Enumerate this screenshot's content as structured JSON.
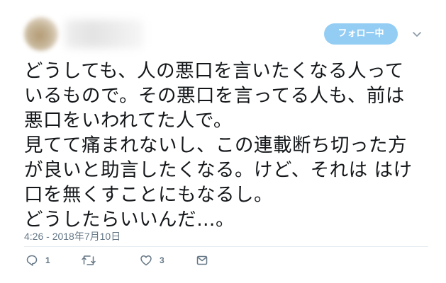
{
  "header": {
    "follow_label": "フォロー中"
  },
  "tweet": {
    "lines": [
      "どうしても、人の悪口を言いたくなる人って",
      "いるもので。その悪口を言ってる人も、前は",
      "悪口をいわれてた人で。",
      "見てて痛まれないし、この連載断ち切った方",
      "が良いと助言したくなる。けど、それは はけ",
      "口を無くすことにもなるし。",
      "どうしたらいいんだ…。"
    ],
    "timestamp": "4:26 - 2018年7月10日"
  },
  "actions": {
    "reply_count": "1",
    "like_count": "3"
  },
  "colors": {
    "follow_button_bg": "#94cdf4",
    "icon_gray": "#657786",
    "text": "#14171a"
  },
  "icons": {
    "caret": "chevron-down-icon",
    "reply": "reply-icon",
    "retweet": "retweet-icon",
    "like": "heart-icon",
    "dm": "envelope-icon"
  }
}
